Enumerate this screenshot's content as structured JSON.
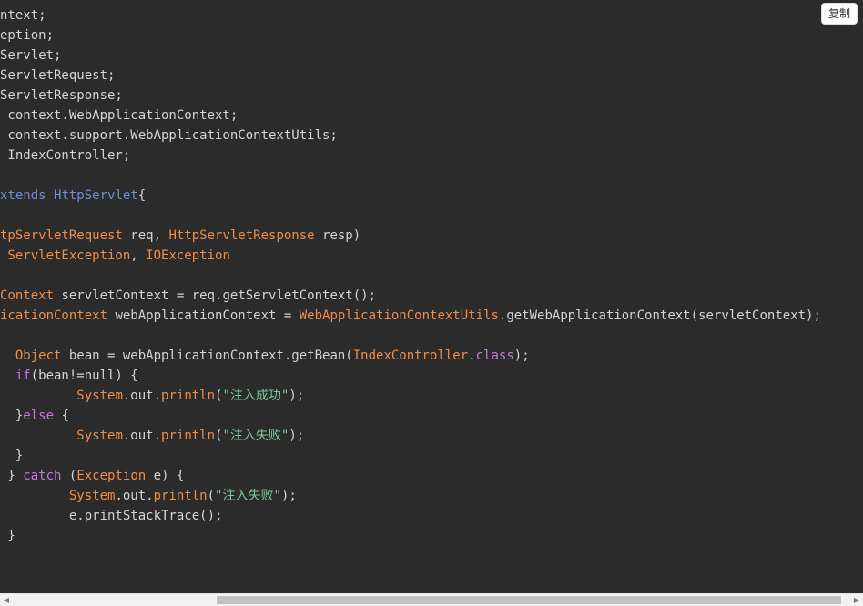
{
  "copy_button": {
    "label": "复制"
  },
  "code": {
    "lines": [
      [
        {
          "t": "ntext;",
          "c": "plain"
        }
      ],
      [
        {
          "t": "eption;",
          "c": "plain"
        }
      ],
      [
        {
          "t": "Servlet;",
          "c": "plain"
        }
      ],
      [
        {
          "t": "ServletRequest;",
          "c": "plain"
        }
      ],
      [
        {
          "t": "ServletResponse;",
          "c": "plain"
        }
      ],
      [
        {
          "t": " context.WebApplicationContext;",
          "c": "plain"
        }
      ],
      [
        {
          "t": " context.support.WebApplicationContextUtils;",
          "c": "plain"
        }
      ],
      [
        {
          "t": " IndexController;",
          "c": "plain"
        }
      ],
      [],
      [
        {
          "t": "xtends ",
          "c": "ext"
        },
        {
          "t": "HttpServlet",
          "c": "ext"
        },
        {
          "t": "{",
          "c": "plain"
        }
      ],
      [],
      [
        {
          "t": "tpServletRequest",
          "c": "type"
        },
        {
          "t": " req, ",
          "c": "plain"
        },
        {
          "t": "HttpServletResponse",
          "c": "type"
        },
        {
          "t": " resp)",
          "c": "plain"
        }
      ],
      [
        {
          "t": " ServletException",
          "c": "type"
        },
        {
          "t": ", ",
          "c": "plain"
        },
        {
          "t": "IOException",
          "c": "type"
        }
      ],
      [],
      [
        {
          "t": "Context",
          "c": "type"
        },
        {
          "t": " servletContext = req.getServletContext();",
          "c": "plain"
        }
      ],
      [
        {
          "t": "icationContext",
          "c": "type"
        },
        {
          "t": " webApplicationContext = ",
          "c": "plain"
        },
        {
          "t": "WebApplicationContextUtils",
          "c": "type"
        },
        {
          "t": ".getWebApplicationContext(servletContext);",
          "c": "plain"
        }
      ],
      [],
      [
        {
          "t": "  ",
          "c": "plain"
        },
        {
          "t": "Object",
          "c": "type"
        },
        {
          "t": " bean = webApplicationContext.getBean(",
          "c": "plain"
        },
        {
          "t": "IndexController",
          "c": "type"
        },
        {
          "t": ".",
          "c": "plain"
        },
        {
          "t": "class",
          "c": "kw"
        },
        {
          "t": ");",
          "c": "plain"
        }
      ],
      [
        {
          "t": "  ",
          "c": "plain"
        },
        {
          "t": "if",
          "c": "kw"
        },
        {
          "t": "(bean!=null) {",
          "c": "plain"
        }
      ],
      [
        {
          "t": "          ",
          "c": "plain"
        },
        {
          "t": "System",
          "c": "type"
        },
        {
          "t": ".out.",
          "c": "plain"
        },
        {
          "t": "println",
          "c": "type"
        },
        {
          "t": "(",
          "c": "plain"
        },
        {
          "t": "\"注入成功\"",
          "c": "str"
        },
        {
          "t": ");",
          "c": "plain"
        }
      ],
      [
        {
          "t": "  }",
          "c": "plain"
        },
        {
          "t": "else",
          "c": "kw"
        },
        {
          "t": " {",
          "c": "plain"
        }
      ],
      [
        {
          "t": "          ",
          "c": "plain"
        },
        {
          "t": "System",
          "c": "type"
        },
        {
          "t": ".out.",
          "c": "plain"
        },
        {
          "t": "println",
          "c": "type"
        },
        {
          "t": "(",
          "c": "plain"
        },
        {
          "t": "\"注入失败\"",
          "c": "str"
        },
        {
          "t": ");",
          "c": "plain"
        }
      ],
      [
        {
          "t": "  }",
          "c": "plain"
        }
      ],
      [
        {
          "t": " } ",
          "c": "plain"
        },
        {
          "t": "catch",
          "c": "kw"
        },
        {
          "t": " (",
          "c": "plain"
        },
        {
          "t": "Exception",
          "c": "type"
        },
        {
          "t": " e) {",
          "c": "plain"
        }
      ],
      [
        {
          "t": "         ",
          "c": "plain"
        },
        {
          "t": "System",
          "c": "type"
        },
        {
          "t": ".out.",
          "c": "plain"
        },
        {
          "t": "println",
          "c": "type"
        },
        {
          "t": "(",
          "c": "plain"
        },
        {
          "t": "\"注入失败\"",
          "c": "str"
        },
        {
          "t": ");",
          "c": "plain"
        }
      ],
      [
        {
          "t": "         e.printStackTrace();",
          "c": "plain"
        }
      ],
      [
        {
          "t": " }",
          "c": "plain"
        }
      ]
    ]
  },
  "scrollbar": {
    "left_arrow": "◀",
    "right_arrow": "▶"
  },
  "colors": {
    "background": "#2b2b2b",
    "plain": "#d4d4d4",
    "keyword": "#c678dd",
    "type": "#f08d49",
    "string": "#7ec699",
    "extends": "#6c8ed8"
  }
}
